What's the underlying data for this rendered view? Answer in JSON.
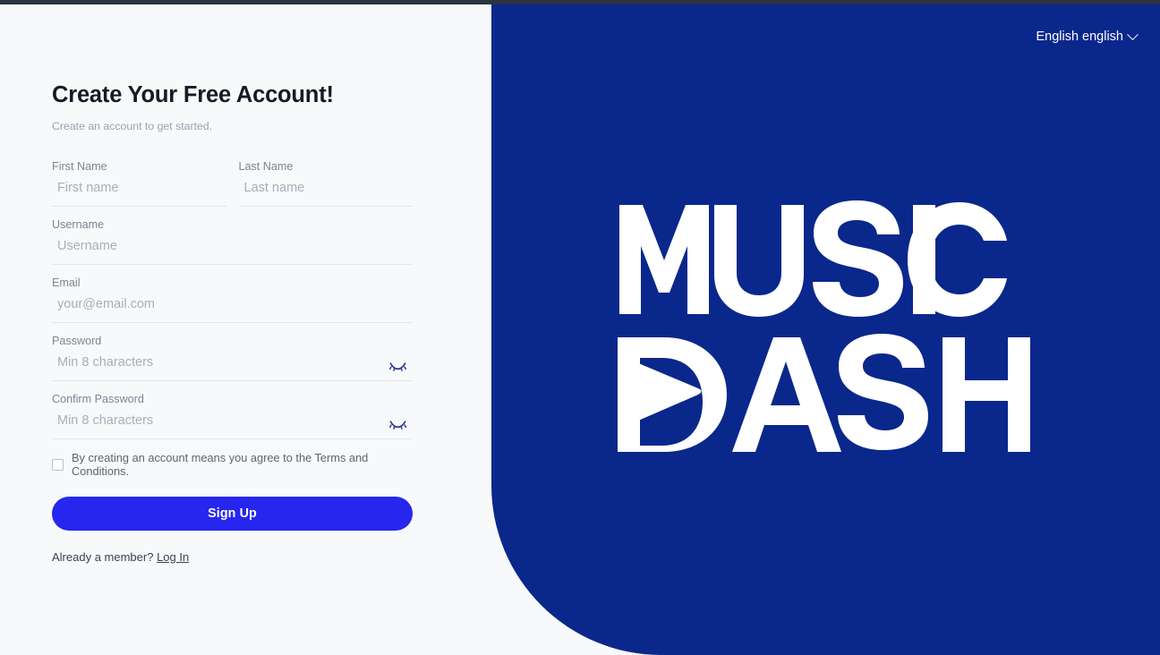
{
  "brand": {
    "panel_color": "#0a278c",
    "logo_line1": "MUSIC",
    "logo_line2": "DASH",
    "logo_alt": "Music Dash"
  },
  "language_switcher": {
    "label": "English english",
    "chevron": "chevron-down-icon"
  },
  "form": {
    "title": "Create Your Free Account!",
    "subtitle": "Create an account to get started.",
    "accent_color": "#2626ef",
    "fields": [
      {
        "label": "First Name",
        "placeholder": "First name",
        "value": "",
        "type": "text"
      },
      {
        "label": "Last Name",
        "placeholder": "Last name",
        "value": "",
        "type": "text"
      },
      {
        "label": "Username",
        "placeholder": "Username",
        "value": "",
        "type": "text"
      },
      {
        "label": "Email",
        "placeholder": "your@email.com",
        "value": "",
        "type": "email"
      },
      {
        "label": "Password",
        "placeholder": "Min 8 characters",
        "value": "",
        "type": "password"
      },
      {
        "label": "Confirm Password",
        "placeholder": "Min 8 characters",
        "value": "",
        "type": "password"
      }
    ],
    "password_toggle_icon": "eye-off-icon",
    "terms": {
      "checked": false,
      "text": "By creating an account means you agree to the Terms and Conditions."
    },
    "submit_label": "Sign Up",
    "footer_prefix": "Already a member?",
    "footer_link": "Log In"
  }
}
